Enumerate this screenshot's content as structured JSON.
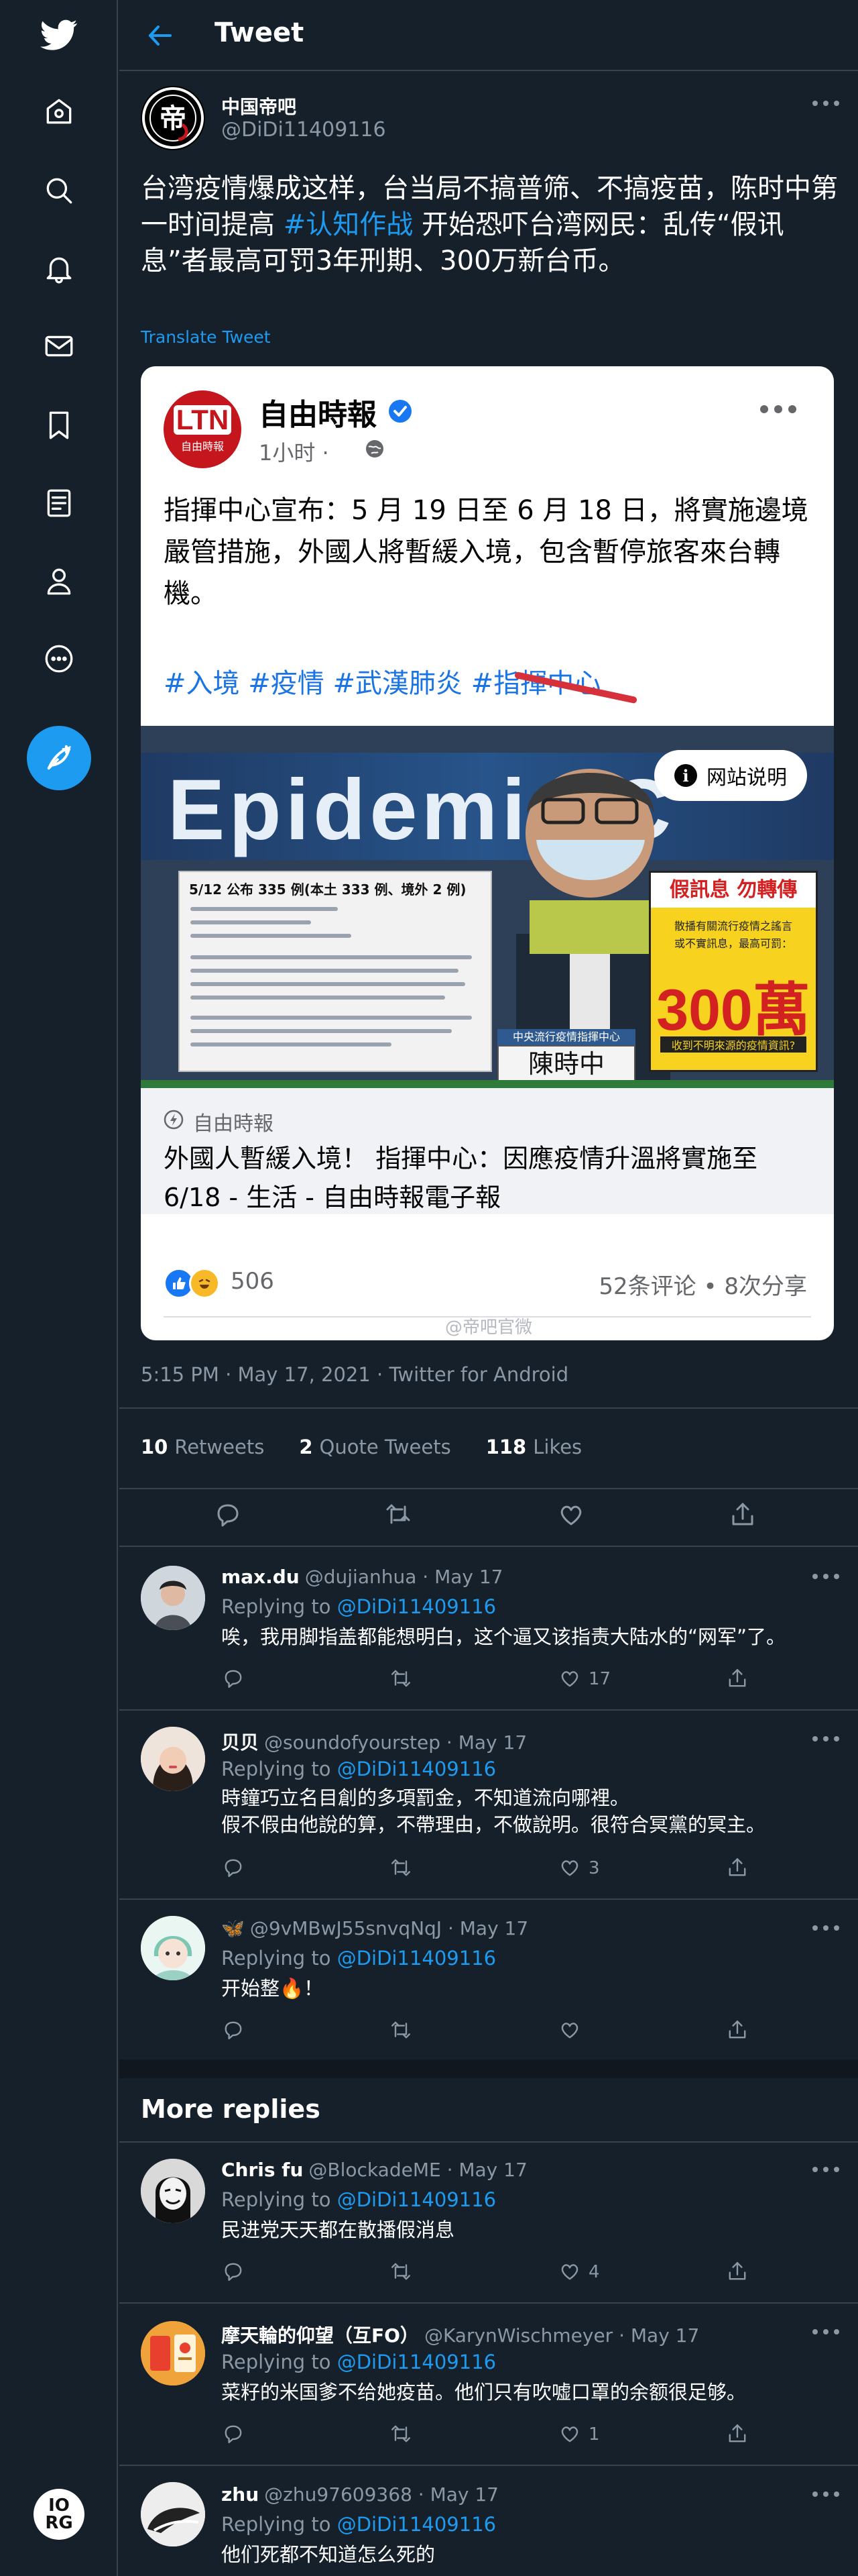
{
  "header": {
    "title": "Tweet"
  },
  "tweet": {
    "author_name": "中国帝吧",
    "author_handle": "@DiDi11409116",
    "text_part1": "台湾疫情爆成这样，台当局不搞普筛、不搞疫苗，陈时中第一时间提高 ",
    "hashtag": "#认知作战",
    "text_part2": " 开始恐吓台湾网民：乱传“假讯息”者最高可罚3年刑期、300万新台币。",
    "translate": "Translate Tweet",
    "meta": "5:15 PM · May 17, 2021 · Twitter for Android",
    "retweets": "10",
    "retweets_label": "Retweets",
    "quotes": "2",
    "quotes_label": "Quote Tweets",
    "likes": "118",
    "likes_label": "Likes"
  },
  "card": {
    "logo_big": "LTN",
    "logo_small": "自由時報",
    "page_name": "自由時報",
    "time": "1小时 ·",
    "body": "指揮中心宣布：5 月 19 日至 6 月 18 日，將實施邊境嚴管措施，外國人將暫緩入境，包含暫停旅客來台轉機。",
    "tags": "#入境 #疫情 #武漢肺炎 #指揮中心",
    "photo_word": "Epidemic C",
    "poster_title": "5/12 公布 335 例(本土 333 例、境外 2 例)",
    "warn_head": "假訊息 勿轉傳",
    "warn_line1": "散播有關流行疫情之謠言",
    "warn_line2": "或不實訊息，最高可罰：",
    "warn_big": "300萬",
    "warn_line3": "收到不明來源的疫情資訊?",
    "nameplate_top": "中央流行疫情指揮中心",
    "nameplate": "陳時中",
    "site_button": "网站说明",
    "link_source": "自由時報",
    "link_title": "外國人暫緩入境！ 指揮中心：因應疫情升溫將實施至6/18 - 生活 - 自由時報電子報",
    "reaction_count": "506",
    "reaction_stats": "52条评论 • 8次分享",
    "watermark": "@帝吧官微"
  },
  "replies": [
    {
      "name": "max.du",
      "handle": "@dujianhua · May 17",
      "reply_to_label": "Replying to",
      "mention": "@DiDi11409116",
      "text": "唉，我用脚指盖都能想明白，这个逼又该指责大陆水的“网军”了。",
      "likes": "17"
    },
    {
      "name": "贝贝",
      "handle": "@soundofyourstep · May 17",
      "reply_to_label": "Replying to",
      "mention": "@DiDi11409116",
      "text": "時鐘巧立名目創的多項罰金，不知道流向哪裡。\n假不假由他說的算，不帶理由，不做說明。很符合冥黨的冥主。",
      "likes": "3"
    },
    {
      "name": "🦋",
      "handle": "@9vMBwJ55snvqNqJ · May 17",
      "reply_to_label": "Replying to",
      "mention": "@DiDi11409116",
      "text": "开始整🔥！",
      "likes": ""
    }
  ],
  "more_replies_title": "More replies",
  "more_replies": [
    {
      "name": "Chris fu",
      "handle": "@BlockadeME · May 17",
      "reply_to_label": "Replying to",
      "mention": "@DiDi11409116",
      "text": "民进党天天都在散播假消息",
      "likes": "4"
    },
    {
      "name": "摩天輪的仰望（互FO）",
      "handle": "@KarynWischmeyer · May 17",
      "reply_to_label": "Replying to",
      "mention": "@DiDi11409116",
      "text": "菜籽的米国爹不给她疫苗。他们只有吹嘘口罩的余额很足够。",
      "likes": "1"
    },
    {
      "name": "zhu",
      "handle": "@zhu97609368 · May 17",
      "reply_to_label": "Replying to",
      "mention": "@DiDi11409116",
      "text": "他们死都不知道怎么死的",
      "likes": ""
    }
  ],
  "nav": {
    "avatar_text": "IO\nRG"
  },
  "colors": {
    "bg": "#15202b",
    "accent": "#1d9bf0",
    "muted": "#8b98a5",
    "border": "#38444d"
  }
}
